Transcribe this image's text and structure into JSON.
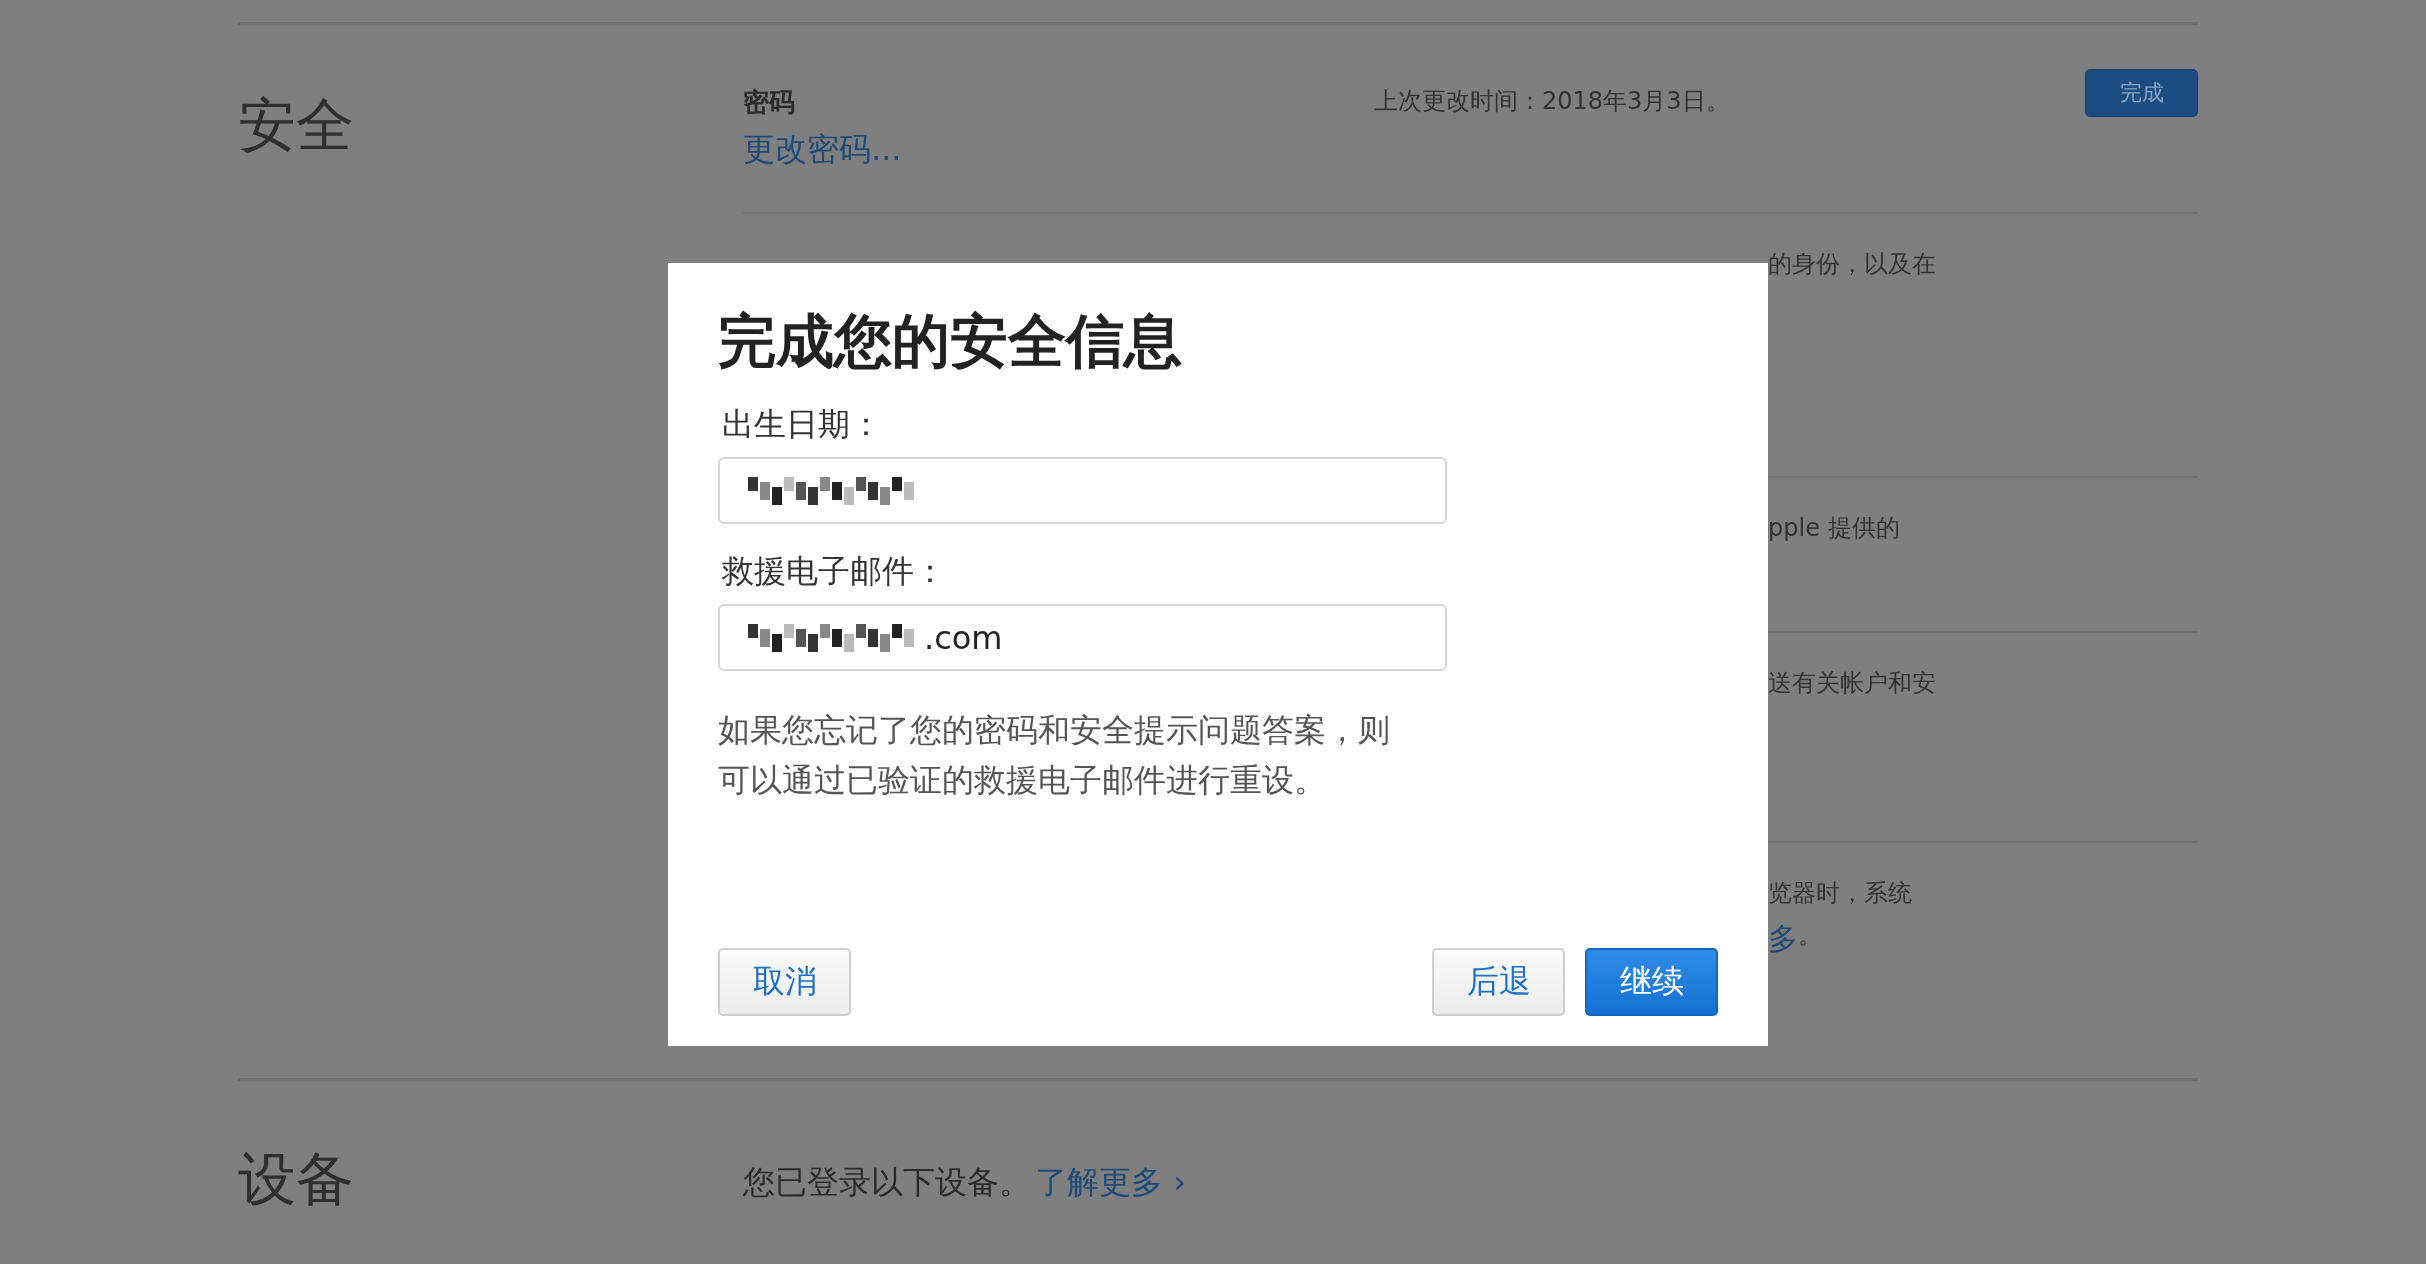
{
  "page": {
    "sections": [
      {
        "heading": "安全",
        "rows": [
          {
            "under_dialog": false,
            "label": "密码",
            "link": "更改密码...",
            "right": [
              [
                {
                  "kind": "plain",
                  "text": "上次更改时间：2018年3月3日。"
                }
              ]
            ],
            "button": {
              "label": "完成"
            }
          },
          {
            "under_dialog": true,
            "right": [
              [
                {
                  "kind": "plain",
                  "text": "的身份，以及在"
                }
              ]
            ]
          },
          {
            "under_dialog": true,
            "right": [
              [
                {
                  "kind": "plain",
                  "text": "pple 提供的"
                }
              ]
            ]
          },
          {
            "under_dialog": true,
            "right": [
              [
                {
                  "kind": "plain",
                  "text": "送有关帐户和安"
                }
              ]
            ]
          },
          {
            "under_dialog": true,
            "right": [
              [
                {
                  "kind": "plain",
                  "text": "览器时，系统"
                }
              ],
              [
                {
                  "kind": "link",
                  "text": "多"
                },
                {
                  "kind": "plain",
                  "text": "。"
                }
              ]
            ]
          }
        ]
      },
      {
        "heading": "设备",
        "intro": [
          {
            "kind": "plain",
            "text": "您已登录以下设备。"
          },
          {
            "kind": "link",
            "text": "了解更多 ›"
          }
        ]
      }
    ]
  },
  "dialog": {
    "title": "完成您的安全信息",
    "fields": [
      {
        "label": "出生日期：",
        "redacted": true
      },
      {
        "label": "救援电子邮件：",
        "redacted": true,
        "value": ".com"
      }
    ],
    "note": "如果您忘记了您的密码和安全提示问题答案，则可以通过已验证的救援电子邮件进行重设。",
    "left_buttons": [
      {
        "label": "取消",
        "primary": false
      }
    ],
    "right_buttons": [
      {
        "label": "后退",
        "primary": false
      },
      {
        "label": "继续",
        "primary": true
      }
    ]
  }
}
